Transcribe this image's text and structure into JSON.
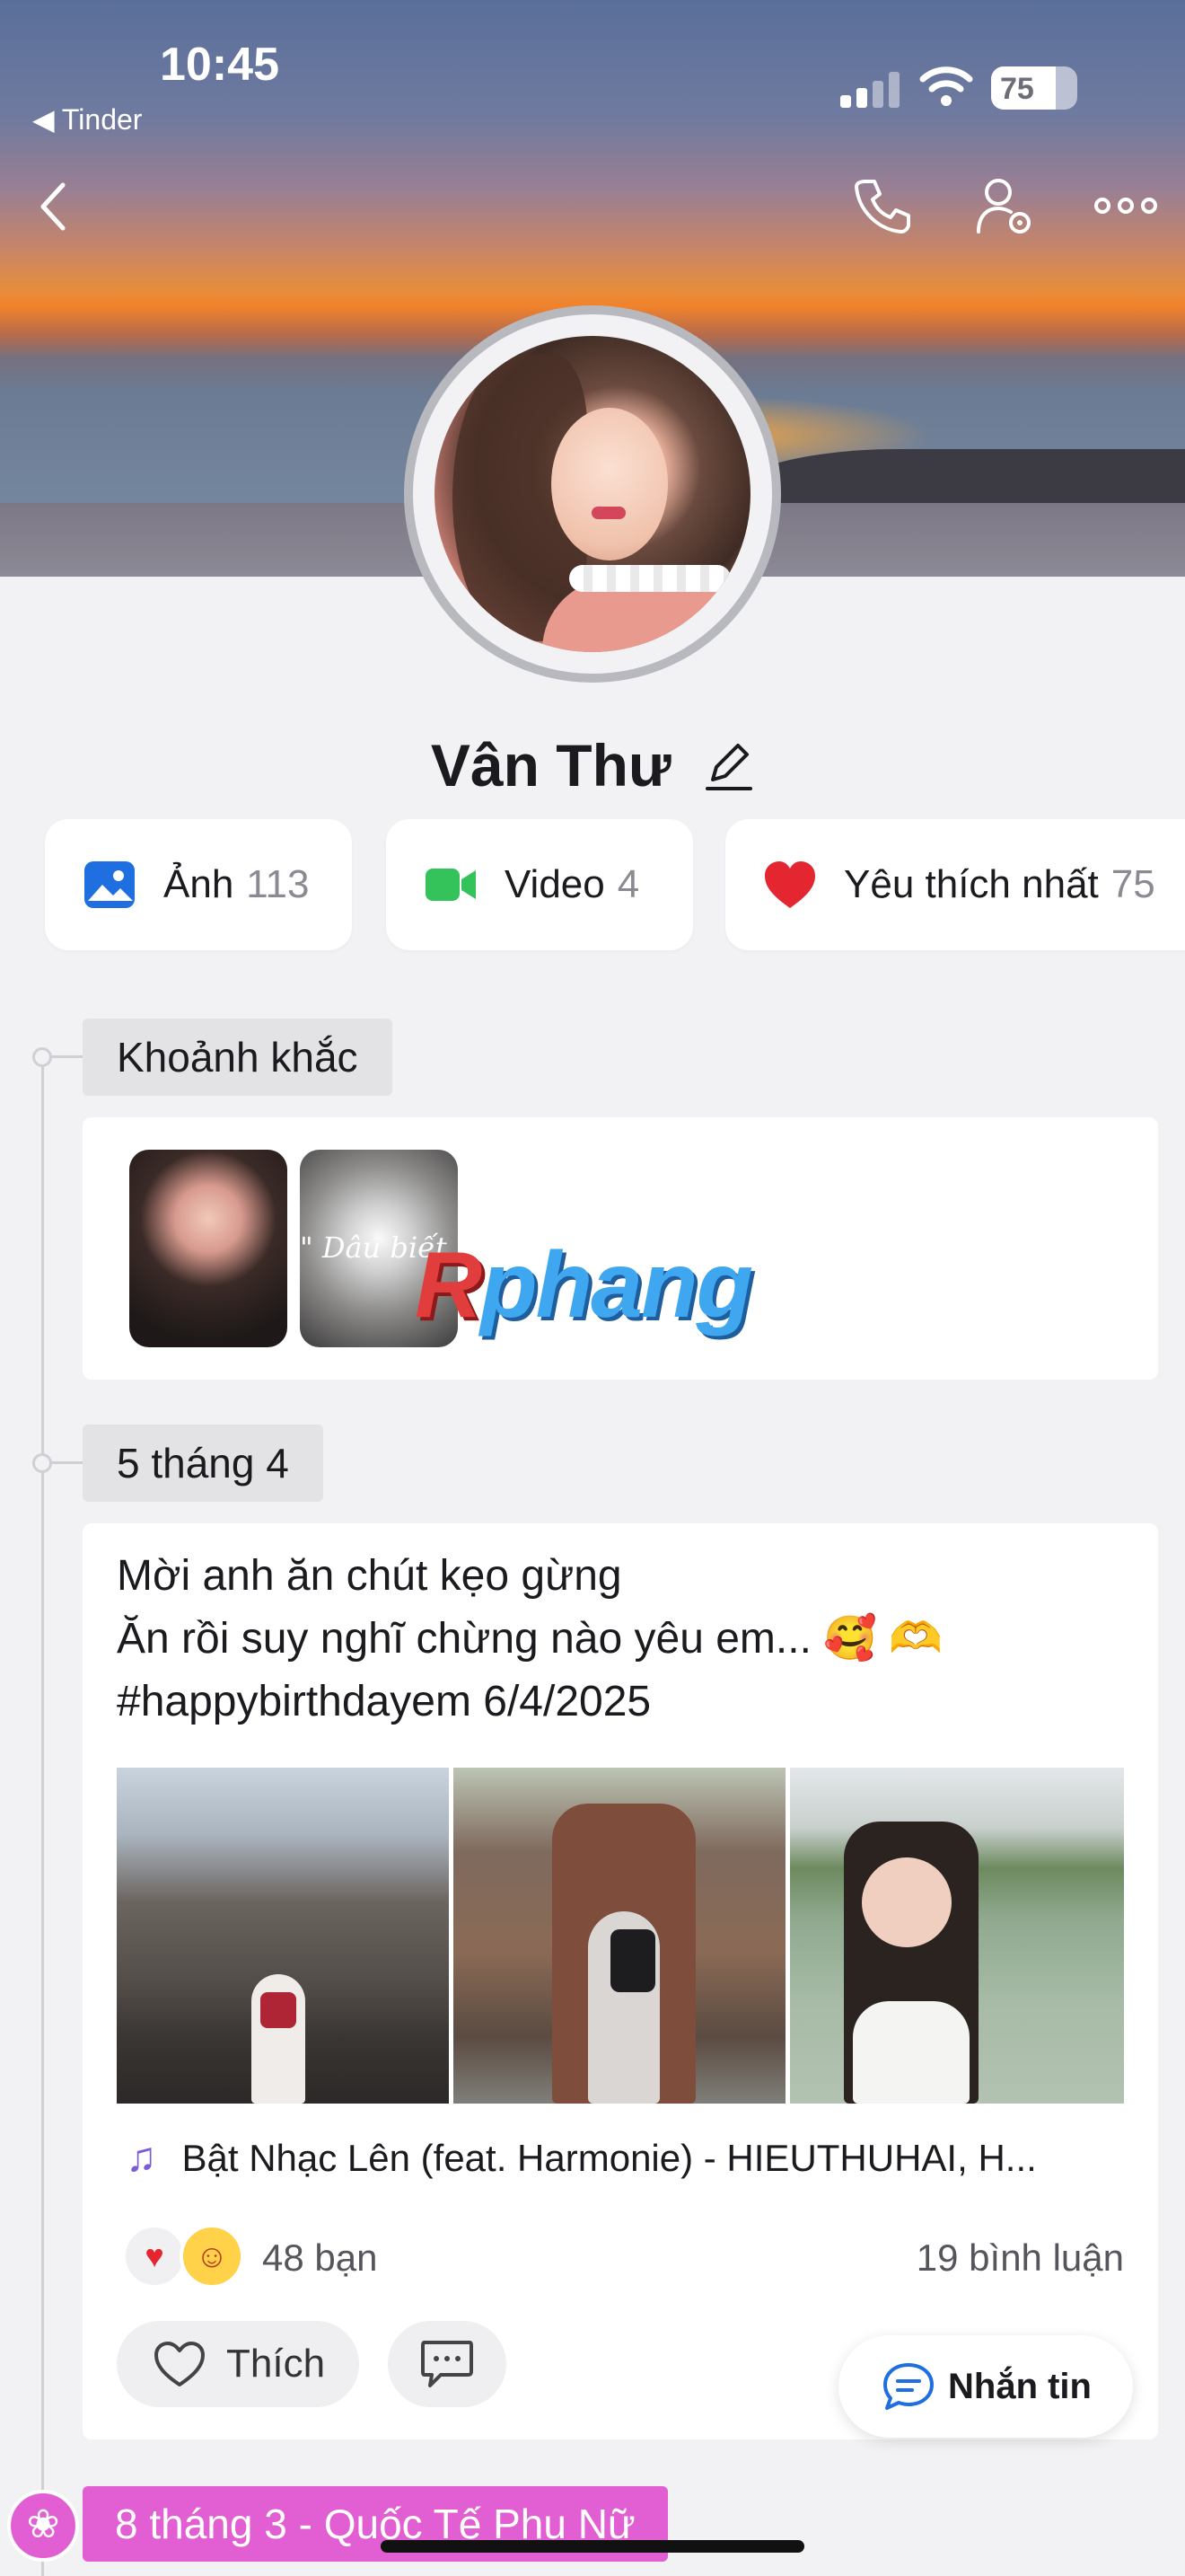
{
  "status_bar": {
    "time": "10:45",
    "back_app": "◀ Tinder",
    "battery": "75"
  },
  "profile": {
    "name": "Vân Thư"
  },
  "chips": [
    {
      "label": "Ảnh",
      "count": "113"
    },
    {
      "label": "Video",
      "count": "4"
    },
    {
      "label": "Yêu thích nhất",
      "count": "75"
    }
  ],
  "timeline": {
    "moments_tag": "Khoảnh khắc",
    "moment_caption": "\" Dâu biết \"",
    "watermark": {
      "r": "R",
      "rest": "phang"
    },
    "post_tag": "5 tháng 4",
    "post": {
      "line1": "Mời anh ăn chút kẹo gừng",
      "line2": "Ăn rồi suy nghĩ chừng nào yêu em... 🥰 🫶",
      "line3": "#happybirthdayem 6/4/2025",
      "music": "Bật Nhạc Lên (feat. Harmonie) - HIEUTHUHAI, H...",
      "reaction_count": "48 bạn",
      "comment_count": "19 bình luận",
      "like_label": "Thích"
    },
    "next_tag": "8 tháng 3 - Quốc Tế Phụ Nữ"
  },
  "message_button": {
    "label": "Nhắn tin"
  },
  "colors": {
    "accent_blue": "#1f6fe0",
    "video_green": "#34c35a",
    "heart_red": "#e3262f",
    "tag_pink": "#e25fd3",
    "music_purple": "#7b5cd6"
  }
}
